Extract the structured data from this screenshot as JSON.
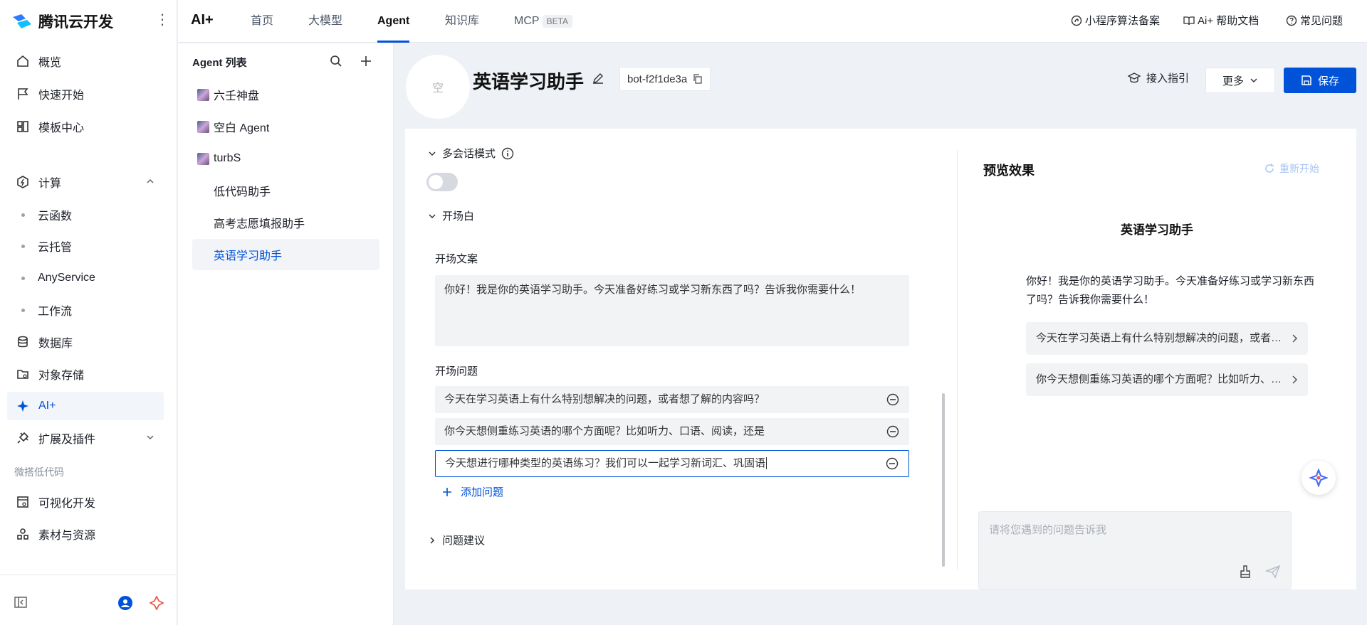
{
  "sidebar": {
    "brand": "腾讯云开发",
    "items": [
      {
        "label": "概览"
      },
      {
        "label": "快速开始"
      },
      {
        "label": "模板中心"
      },
      {
        "label": "计算"
      },
      {
        "label": "云函数"
      },
      {
        "label": "云托管"
      },
      {
        "label": "AnyService"
      },
      {
        "label": "工作流"
      },
      {
        "label": "数据库"
      },
      {
        "label": "对象存储"
      },
      {
        "label": "AI+"
      },
      {
        "label": "扩展及插件"
      },
      {
        "label": "可视化开发"
      },
      {
        "label": "素材与资源"
      }
    ],
    "section_lowcode": "微搭低代码"
  },
  "topbar": {
    "title": "AI+",
    "tabs": [
      {
        "label": "首页"
      },
      {
        "label": "大模型"
      },
      {
        "label": "Agent"
      },
      {
        "label": "知识库"
      },
      {
        "label": "MCP"
      }
    ],
    "beta": "BETA",
    "links": [
      {
        "label": "小程序算法备案"
      },
      {
        "label": "Ai+ 帮助文档"
      },
      {
        "label": "常见问题"
      }
    ]
  },
  "agent_list": {
    "title": "Agent 列表",
    "items": [
      {
        "label": "六壬神盘"
      },
      {
        "label": "空白 Agent"
      },
      {
        "label": "turbS"
      },
      {
        "label": "低代码助手"
      },
      {
        "label": "高考志愿填报助手"
      },
      {
        "label": "英语学习助手"
      }
    ]
  },
  "agent": {
    "avatar_text": "空",
    "name": "英语学习助手",
    "bot_id": "bot-f2f1de3a",
    "guide_label": "接入指引",
    "more_label": "更多",
    "save_label": "保存"
  },
  "config": {
    "multi_session": "多会话模式",
    "opening": "开场白",
    "opening_text_label": "开场文案",
    "opening_text": "你好！我是你的英语学习助手。今天准备好练习或学习新东西了吗？告诉我你需要什么！",
    "opening_questions_label": "开场问题",
    "questions": [
      "今天在学习英语上有什么特别想解决的问题，或者想了解的内容吗？",
      "你今天想侧重练习英语的哪个方面呢？比如听力、口语、阅读，还是",
      "今天想进行哪种类型的英语练习？我们可以一起学习新词汇、巩固语"
    ],
    "add_question": "添加问题",
    "suggestions": "问题建议"
  },
  "preview": {
    "title": "预览效果",
    "restart": "重新开始",
    "bot_name": "英语学习助手",
    "greeting": "你好！我是你的英语学习助手。今天准备好练习或学习新东西了吗？告诉我你需要什么！",
    "questions": [
      "今天在学习英语上有什么特别想解决的问题，或者想了解的内容吗？",
      "你今天想侧重练习英语的哪个方面呢？比如听力、口语、阅读，还是"
    ],
    "input_placeholder": "请将您遇到的问题告诉我"
  },
  "colors": {
    "accent": "#0052d9",
    "sidebar_active_bg": "#f2f5fa",
    "field_bg": "#f2f3f5"
  }
}
